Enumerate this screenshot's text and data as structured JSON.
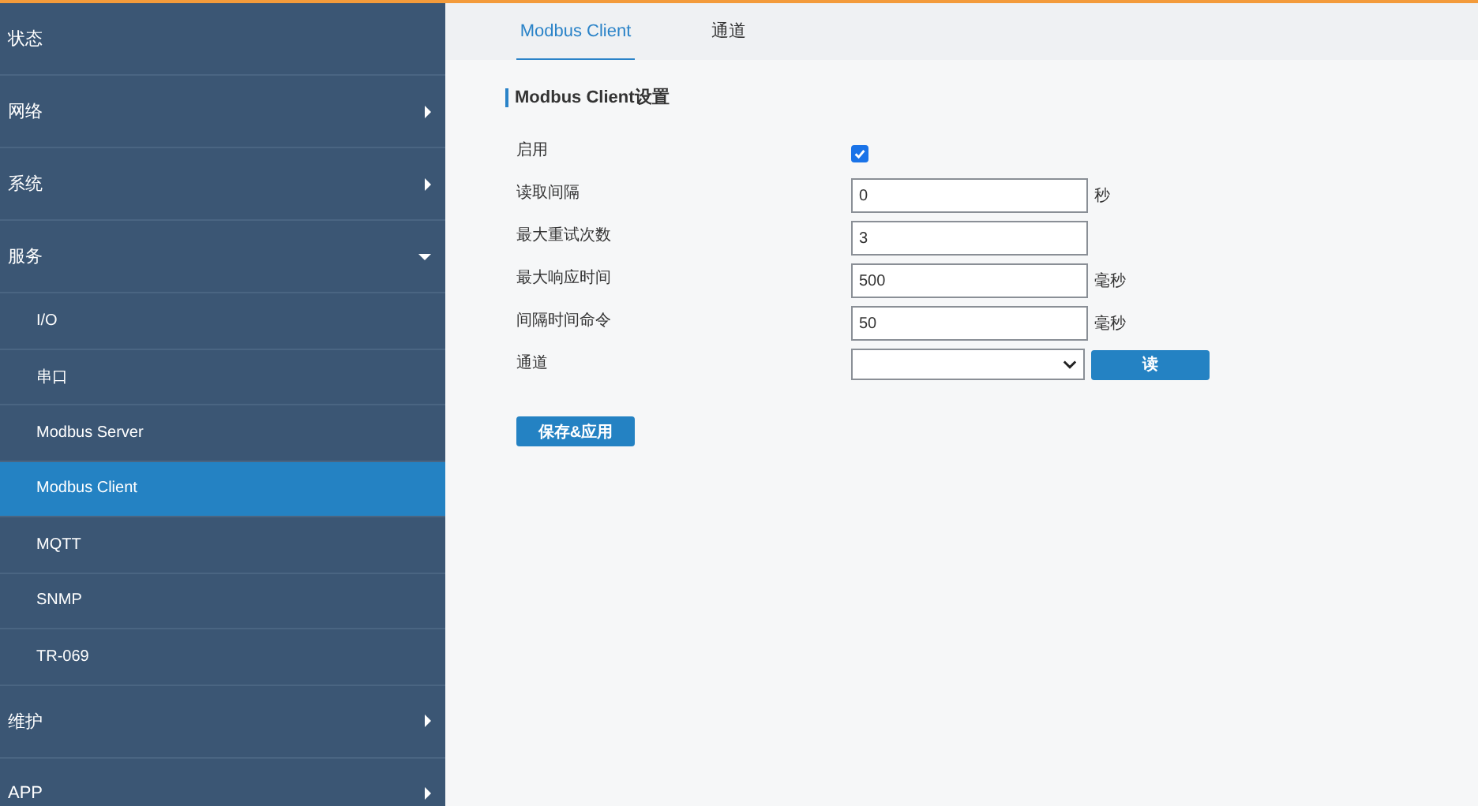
{
  "sidebar": {
    "items": [
      {
        "label": "状态",
        "kind": "link",
        "selected": false
      },
      {
        "label": "网络",
        "kind": "group",
        "expanded": false,
        "selected": false
      },
      {
        "label": "系统",
        "kind": "group",
        "expanded": false,
        "selected": false
      },
      {
        "label": "服务",
        "kind": "group",
        "expanded": true,
        "selected": false,
        "children": [
          {
            "label": "I/O",
            "selected": false
          },
          {
            "label": "串口",
            "selected": false
          },
          {
            "label": "Modbus Server",
            "selected": false
          },
          {
            "label": "Modbus Client",
            "selected": true
          },
          {
            "label": "MQTT",
            "selected": false
          },
          {
            "label": "SNMP",
            "selected": false
          },
          {
            "label": "TR-069",
            "selected": false
          }
        ]
      },
      {
        "label": "维护",
        "kind": "group",
        "expanded": false,
        "selected": false
      },
      {
        "label": "APP",
        "kind": "group",
        "expanded": false,
        "selected": false
      }
    ]
  },
  "tabs": [
    {
      "label": "Modbus Client",
      "selected": true
    },
    {
      "label": "通道",
      "selected": false
    }
  ],
  "section_title": "Modbus Client设置",
  "fields": [
    {
      "kind": "checkbox",
      "label": "启用",
      "checked": true
    },
    {
      "kind": "text",
      "label": "读取间隔",
      "value": "0",
      "unit": "秒"
    },
    {
      "kind": "text",
      "label": "最大重试次数",
      "value": "3"
    },
    {
      "kind": "text",
      "label": "最大响应时间",
      "value": "500",
      "unit": "毫秒"
    },
    {
      "kind": "text",
      "label": "间隔时间命令",
      "value": "50",
      "unit": "毫秒"
    },
    {
      "kind": "select",
      "label": "通道",
      "button": "读"
    }
  ],
  "save_button": "保存&应用"
}
